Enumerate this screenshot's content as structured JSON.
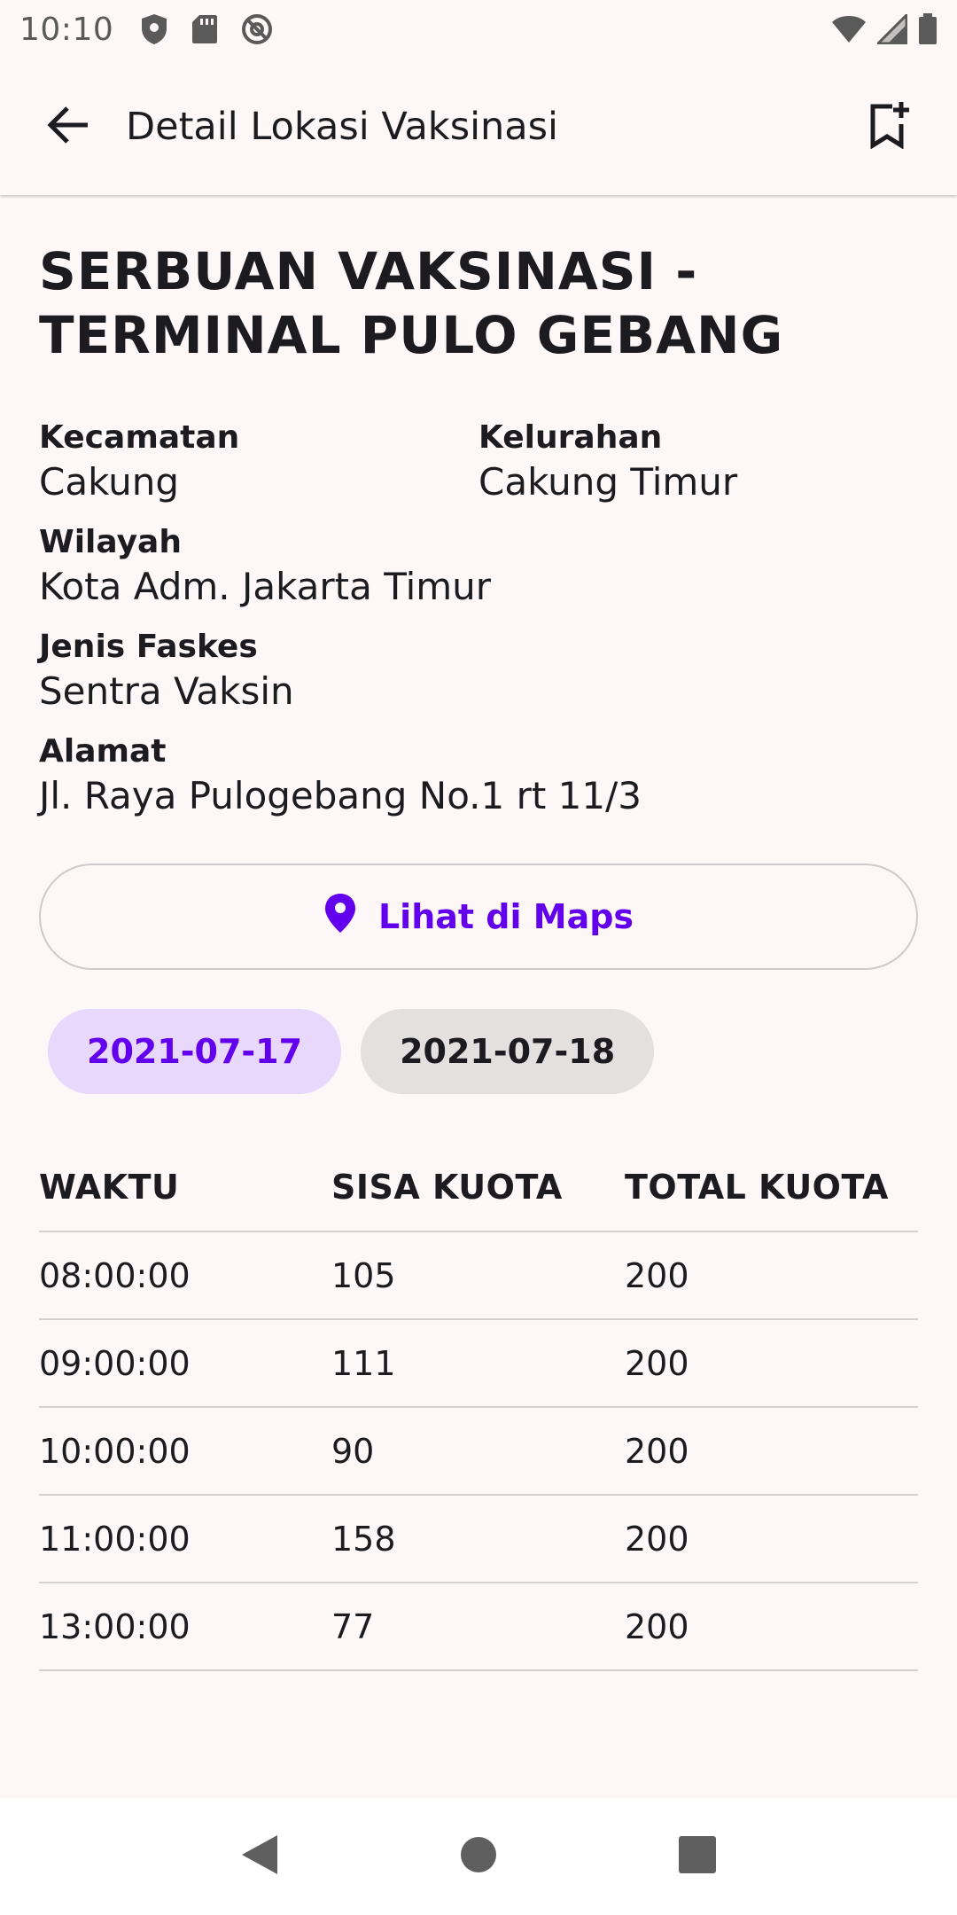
{
  "status_bar": {
    "time": "10:10",
    "icons_left": [
      "shield-icon",
      "sd-card-icon",
      "at-sign-icon"
    ],
    "icons_right": [
      "wifi-icon",
      "signal-icon",
      "battery-icon"
    ]
  },
  "app_bar": {
    "title": "Detail Lokasi Vaksinasi",
    "back_icon": "arrow-back-icon",
    "bookmark_icon": "bookmark-add-icon"
  },
  "location": {
    "name": "SERBUAN VAKSINASI - TERMINAL PULO GEBANG",
    "kecamatan_label": "Kecamatan",
    "kecamatan_value": "Cakung",
    "kelurahan_label": "Kelurahan",
    "kelurahan_value": "Cakung Timur",
    "wilayah_label": "Wilayah",
    "wilayah_value": "Kota Adm. Jakarta Timur",
    "jenis_faskes_label": "Jenis Faskes",
    "jenis_faskes_value": "Sentra Vaksin",
    "alamat_label": "Alamat",
    "alamat_value": "Jl. Raya Pulogebang No.1 rt 11/3"
  },
  "maps_button": {
    "label": "Lihat di Maps",
    "icon": "location-pin-icon"
  },
  "date_chips": [
    {
      "label": "2021-07-17",
      "selected": true
    },
    {
      "label": "2021-07-18",
      "selected": false
    }
  ],
  "quota_table": {
    "headers": [
      "WAKTU",
      "SISA KUOTA",
      "TOTAL KUOTA"
    ],
    "rows": [
      [
        "08:00:00",
        "105",
        "200"
      ],
      [
        "09:00:00",
        "111",
        "200"
      ],
      [
        "10:00:00",
        "90",
        "200"
      ],
      [
        "11:00:00",
        "158",
        "200"
      ],
      [
        "13:00:00",
        "77",
        "200"
      ]
    ]
  },
  "nav_bar": {
    "icons": [
      "nav-back-icon",
      "nav-home-icon",
      "nav-recents-icon"
    ]
  },
  "colors": {
    "accent": "#6200ee",
    "chip_selected_bg": "#e8d8fb",
    "chip_unselected_bg": "#e3e0df",
    "background": "#fdf8f7"
  }
}
